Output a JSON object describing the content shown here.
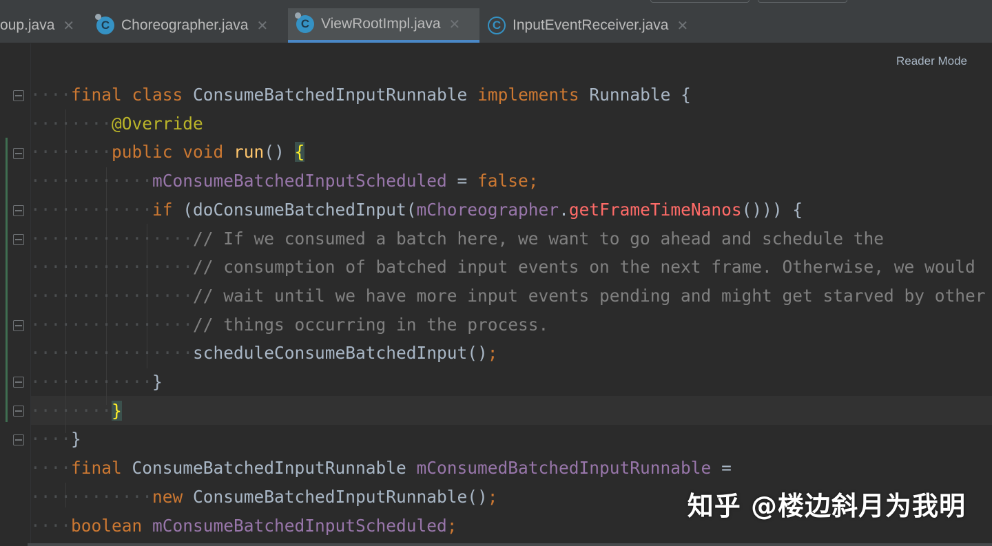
{
  "tabs": [
    {
      "label": "oup.java",
      "icon": "class-icon",
      "active": false
    },
    {
      "label": "Choreographer.java",
      "icon": "class-icon",
      "active": false
    },
    {
      "label": "ViewRootImpl.java",
      "icon": "class-icon",
      "active": true
    },
    {
      "label": "InputEventReceiver.java",
      "icon": "class-icon",
      "active": false
    }
  ],
  "editor": {
    "reader_mode": "Reader Mode",
    "lines": [
      {
        "dots": "····",
        "segs": [
          [
            "kw",
            "final "
          ],
          [
            "kw",
            "class "
          ],
          [
            "cls",
            "ConsumeBatchedInputRunnable "
          ],
          [
            "kw",
            "implements "
          ],
          [
            "cls",
            "Runnable {"
          ]
        ]
      },
      {
        "dots": "········",
        "segs": [
          [
            "ann",
            "@Override"
          ]
        ]
      },
      {
        "dots": "········",
        "segs": [
          [
            "kw",
            "public "
          ],
          [
            "kw",
            "void "
          ],
          [
            "mth",
            "run"
          ],
          [
            "cls",
            "() "
          ],
          [
            "brk",
            "{"
          ]
        ]
      },
      {
        "dots": "············",
        "segs": [
          [
            "fld",
            "mConsumeBatchedInputScheduled"
          ],
          [
            "cls",
            " = "
          ],
          [
            "kw",
            "false;"
          ]
        ]
      },
      {
        "dots": "············",
        "segs": [
          [
            "kw",
            "if "
          ],
          [
            "cls",
            "(doConsumeBatchedInput("
          ],
          [
            "fld",
            "mChoreographer"
          ],
          [
            "cls",
            "."
          ],
          [
            "call",
            "getFrameTimeNanos"
          ],
          [
            "cls",
            "())) {"
          ]
        ]
      },
      {
        "dots": "················",
        "segs": [
          [
            "cmt",
            "// If we consumed a batch here, we want to go ahead and schedule the"
          ]
        ]
      },
      {
        "dots": "················",
        "segs": [
          [
            "cmt",
            "// consumption of batched input events on the next frame. Otherwise, we would"
          ]
        ]
      },
      {
        "dots": "················",
        "segs": [
          [
            "cmt",
            "// wait until we have more input events pending and might get starved by other"
          ]
        ]
      },
      {
        "dots": "················",
        "segs": [
          [
            "cmt",
            "// things occurring in the process."
          ]
        ]
      },
      {
        "dots": "················",
        "segs": [
          [
            "cls",
            "scheduleConsumeBatchedInput()"
          ],
          [
            "kw",
            ";"
          ]
        ]
      },
      {
        "dots": "············",
        "segs": [
          [
            "cls",
            "}"
          ]
        ]
      },
      {
        "dots": "········",
        "segs": [
          [
            "brk",
            "}"
          ]
        ]
      },
      {
        "dots": "····",
        "segs": [
          [
            "cls",
            "}"
          ]
        ]
      },
      {
        "dots": "····",
        "segs": [
          [
            "kw",
            "final "
          ],
          [
            "cls",
            "ConsumeBatchedInputRunnable "
          ],
          [
            "fld",
            "mConsumedBatchedInputRunnable"
          ],
          [
            "cls",
            " ="
          ]
        ]
      },
      {
        "dots": "············",
        "segs": [
          [
            "kw",
            "new "
          ],
          [
            "cls",
            "ConsumeBatchedInputRunnable()"
          ],
          [
            "kw",
            ";"
          ]
        ]
      },
      {
        "dots": "····",
        "segs": [
          [
            "kw",
            "boolean "
          ],
          [
            "fld",
            "mConsumeBatchedInputScheduled"
          ],
          [
            "kw",
            ";"
          ]
        ]
      }
    ]
  },
  "watermark": "知乎 @楼边斜月为我明",
  "colors": {
    "background": "#2b2b2b",
    "tab_active_underline": "#4a88c7",
    "keyword": "#cc7832",
    "field": "#9876aa",
    "method": "#ffc66d",
    "comment": "#808080",
    "annotation": "#bbb529"
  }
}
